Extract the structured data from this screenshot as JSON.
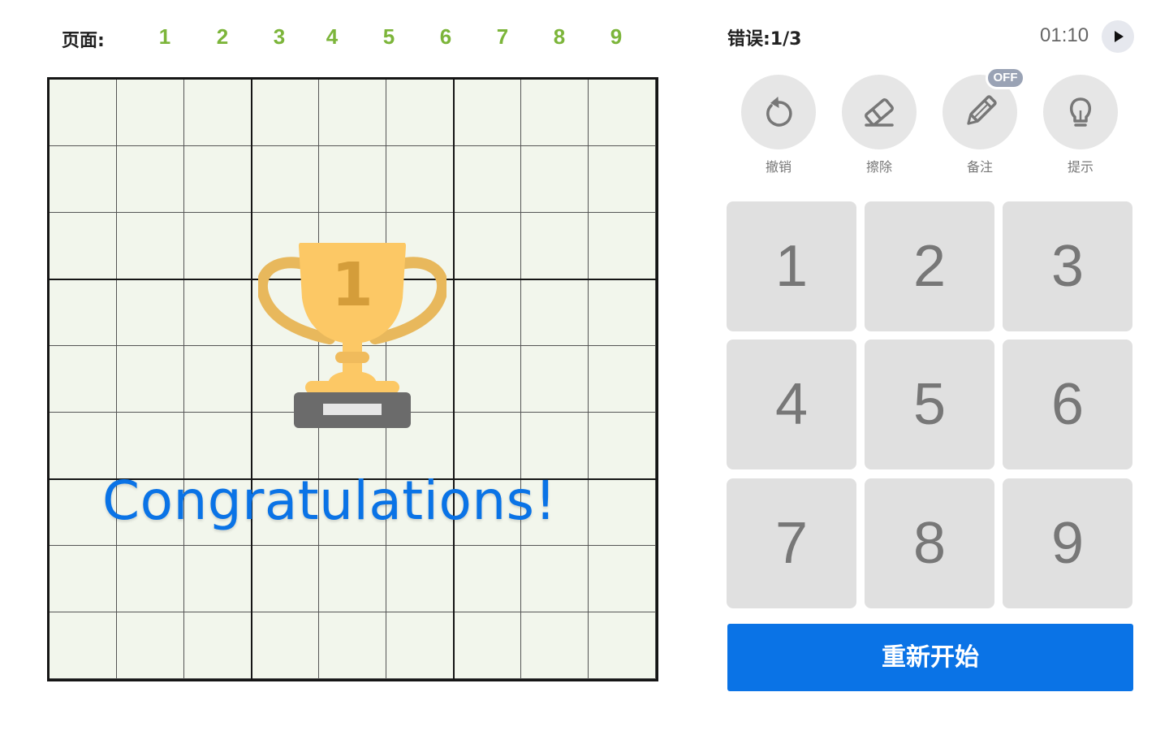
{
  "pages": {
    "label": "页面:",
    "items": [
      "1",
      "2",
      "3",
      "4",
      "5",
      "6",
      "7",
      "8",
      "9"
    ]
  },
  "trophy": {
    "rank": "1",
    "message": "Congratulations!"
  },
  "status": {
    "mistakes": "错误:1/3",
    "timer": "01:10"
  },
  "tools": [
    {
      "label": "撤销",
      "icon": "undo-icon"
    },
    {
      "label": "擦除",
      "icon": "eraser-icon"
    },
    {
      "label": "备注",
      "icon": "pencil-icon"
    },
    {
      "label": "提示",
      "icon": "lightbulb-icon"
    }
  ],
  "notes_badge": "OFF",
  "numpad": [
    "1",
    "2",
    "3",
    "4",
    "5",
    "6",
    "7",
    "8",
    "9"
  ],
  "restart_label": "重新开始",
  "colors": {
    "accent": "#0a73e6",
    "page_link": "#7cb53a",
    "board_bg": "#f2f6ec",
    "trophy_gold": "#fcc865",
    "trophy_base": "#6b6b6b"
  }
}
